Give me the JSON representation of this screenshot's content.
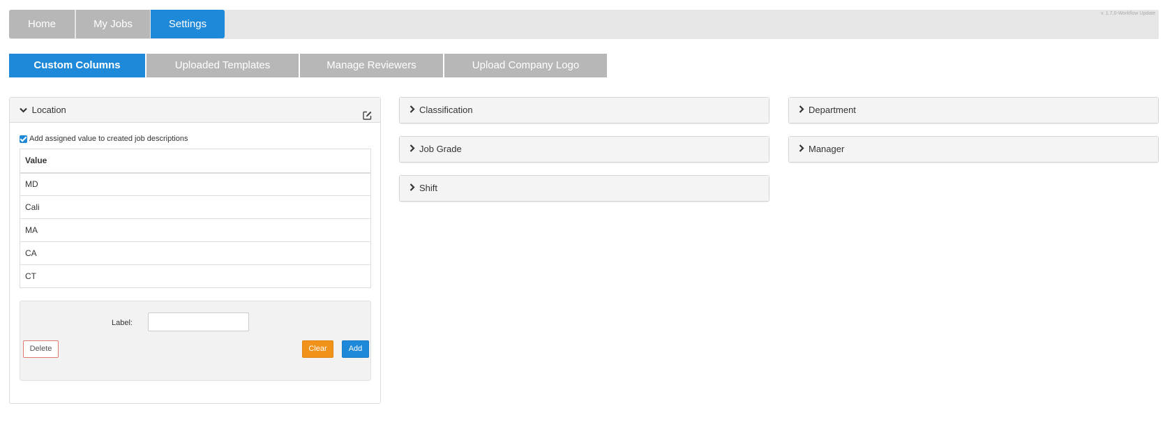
{
  "version": "v. 1.7.0-Workflow Update",
  "nav": {
    "home": "Home",
    "my_jobs": "My Jobs",
    "settings": "Settings"
  },
  "subtabs": {
    "custom_columns": "Custom Columns",
    "uploaded_templates": "Uploaded Templates",
    "manage_reviewers": "Manage Reviewers",
    "upload_company_logo": "Upload Company Logo"
  },
  "location_panel": {
    "title": "Location",
    "checkbox_label": "Add assigned value to created job descriptions",
    "column_header": "Value",
    "values": [
      "MD",
      "Cali",
      "MA",
      "CA",
      "CT"
    ],
    "form": {
      "label": "Label:",
      "input_value": "",
      "delete": "Delete",
      "clear": "Clear",
      "add": "Add"
    }
  },
  "panels": {
    "classification": "Classification",
    "job_grade": "Job Grade",
    "shift": "Shift",
    "department": "Department",
    "manager": "Manager"
  },
  "colors": {
    "accent": "#1e88d9",
    "inactive_tab": "#b7b7b7",
    "clear_button": "#f1931a",
    "delete_border": "#e07a6f"
  }
}
